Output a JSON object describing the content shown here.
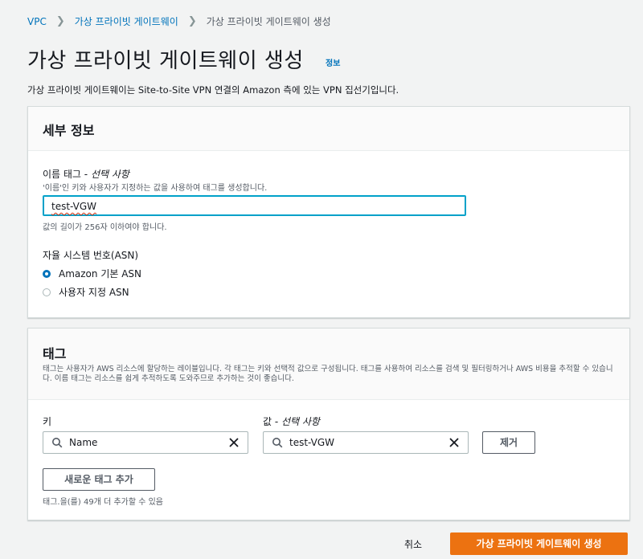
{
  "breadcrumb": {
    "items": [
      "VPC",
      "가상 프라이빗 게이트웨이",
      "가상 프라이빗 게이트웨이 생성"
    ]
  },
  "page": {
    "title": "가상 프라이빗 게이트웨이 생성",
    "info_link": "정보",
    "description": "가상 프라이빗 게이트웨이는 Site-to-Site VPN 연결의 Amazon 측에 있는 VPN 집선기입니다."
  },
  "details": {
    "heading": "세부 정보",
    "name_tag_label": "이름 태그 - ",
    "name_tag_optional": "선택 사항",
    "name_tag_desc": "'이름'인 키와 사용자가 지정하는 값을 사용하여 태그를 생성합니다.",
    "name_tag_value": "test-VGW",
    "name_tag_hint": "값의 길이가 256자 이하여야 합니다.",
    "asn_label": "자율 시스템 번호(ASN)",
    "asn_options": [
      "Amazon 기본 ASN",
      "사용자 지정 ASN"
    ],
    "asn_selected": "Amazon 기본 ASN"
  },
  "tags": {
    "heading": "태그",
    "description": "태그는 사용자가 AWS 리소스에 할당하는 레이블입니다. 각 태그는 키와 선택적 값으로 구성됩니다. 태그를 사용하여 리소스를 검색 및 필터링하거나 AWS 비용을 추적할 수 있습니다. 이름 태그는 리소스를 쉽게 추적하도록 도와주므로 추가하는 것이 좋습니다.",
    "key_label": "키",
    "value_label": "값 - ",
    "value_optional": "선택 사항",
    "rows": [
      {
        "key": "Name",
        "value": "test-VGW",
        "remove_label": "제거"
      }
    ],
    "add_button": "새로운 태그 추가",
    "remaining_hint": "태그.을(를) 49개 더 추가할 수 있음"
  },
  "footer": {
    "cancel_label": "취소",
    "create_label": "가상 프라이빗 게이트웨이 생성"
  },
  "colors": {
    "link": "#0073bb",
    "primary": "#ec7211",
    "focus": "#00a1c9",
    "page_bg": "#f2f3f3"
  }
}
